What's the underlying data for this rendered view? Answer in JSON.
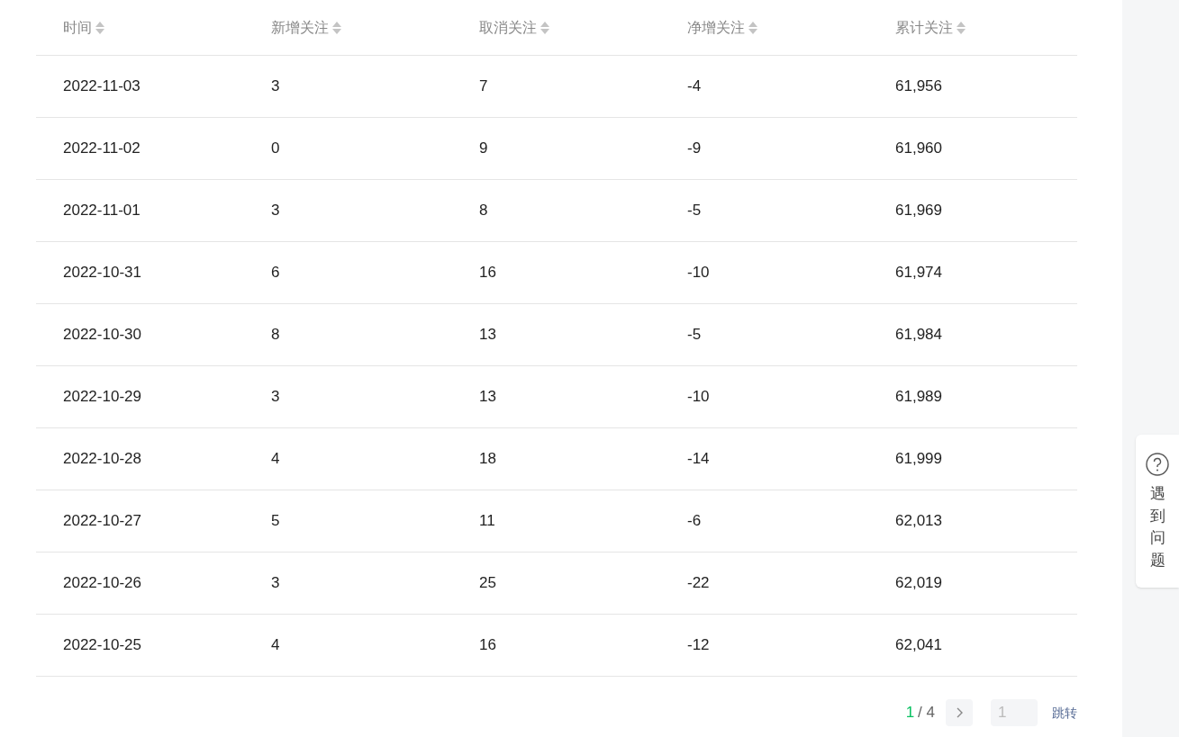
{
  "table": {
    "columns": [
      "时间",
      "新增关注",
      "取消关注",
      "净增关注",
      "累计关注"
    ],
    "rows": [
      {
        "cells": [
          "2022-11-03",
          "3",
          "7",
          "-4",
          "61,956"
        ]
      },
      {
        "cells": [
          "2022-11-02",
          "0",
          "9",
          "-9",
          "61,960"
        ]
      },
      {
        "cells": [
          "2022-11-01",
          "3",
          "8",
          "-5",
          "61,969"
        ]
      },
      {
        "cells": [
          "2022-10-31",
          "6",
          "16",
          "-10",
          "61,974"
        ]
      },
      {
        "cells": [
          "2022-10-30",
          "8",
          "13",
          "-5",
          "61,984"
        ]
      },
      {
        "cells": [
          "2022-10-29",
          "3",
          "13",
          "-10",
          "61,989"
        ]
      },
      {
        "cells": [
          "2022-10-28",
          "4",
          "18",
          "-14",
          "61,999"
        ]
      },
      {
        "cells": [
          "2022-10-27",
          "5",
          "11",
          "-6",
          "62,013"
        ]
      },
      {
        "cells": [
          "2022-10-26",
          "3",
          "25",
          "-22",
          "62,019"
        ]
      },
      {
        "cells": [
          "2022-10-25",
          "4",
          "16",
          "-12",
          "62,041"
        ]
      }
    ]
  },
  "pagination": {
    "current": "1",
    "total": "/ 4",
    "jump_placeholder": "1",
    "jump_label": "跳转"
  },
  "help": {
    "label": "遇到问题"
  }
}
